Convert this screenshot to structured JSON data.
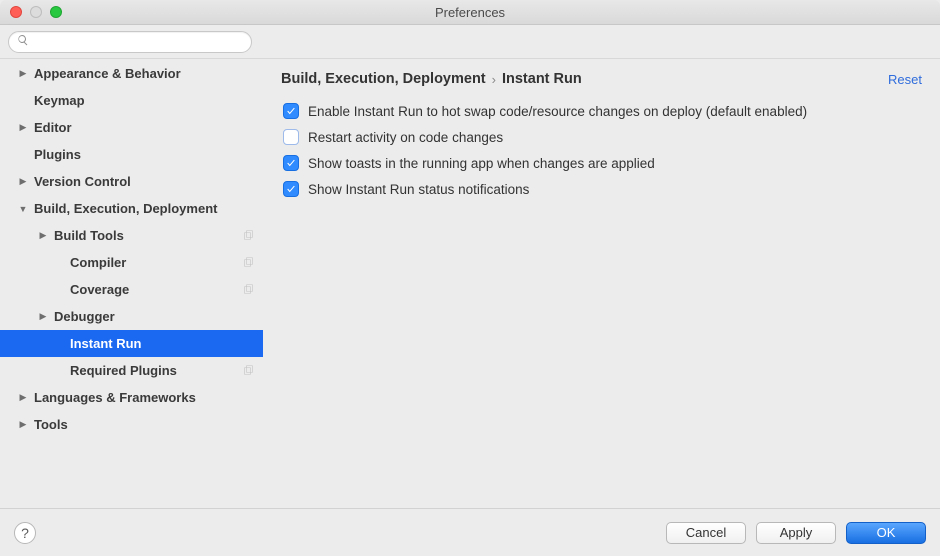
{
  "window": {
    "title": "Preferences"
  },
  "search": {
    "placeholder": ""
  },
  "sidebar": {
    "items": [
      {
        "label": "Appearance & Behavior",
        "depth": 0,
        "arrow": "right",
        "badge": false,
        "selected": false
      },
      {
        "label": "Keymap",
        "depth": 0,
        "arrow": "none",
        "badge": false,
        "selected": false
      },
      {
        "label": "Editor",
        "depth": 0,
        "arrow": "right",
        "badge": false,
        "selected": false
      },
      {
        "label": "Plugins",
        "depth": 0,
        "arrow": "none",
        "badge": false,
        "selected": false
      },
      {
        "label": "Version Control",
        "depth": 0,
        "arrow": "right",
        "badge": false,
        "selected": false
      },
      {
        "label": "Build, Execution, Deployment",
        "depth": 0,
        "arrow": "down",
        "badge": false,
        "selected": false
      },
      {
        "label": "Build Tools",
        "depth": 1,
        "arrow": "right",
        "badge": true,
        "selected": false
      },
      {
        "label": "Compiler",
        "depth": 2,
        "arrow": "none",
        "badge": true,
        "selected": false
      },
      {
        "label": "Coverage",
        "depth": 2,
        "arrow": "none",
        "badge": true,
        "selected": false
      },
      {
        "label": "Debugger",
        "depth": 1,
        "arrow": "right",
        "badge": false,
        "selected": false
      },
      {
        "label": "Instant Run",
        "depth": 2,
        "arrow": "none",
        "badge": false,
        "selected": true
      },
      {
        "label": "Required Plugins",
        "depth": 2,
        "arrow": "none",
        "badge": true,
        "selected": false
      },
      {
        "label": "Languages & Frameworks",
        "depth": 0,
        "arrow": "right",
        "badge": false,
        "selected": false
      },
      {
        "label": "Tools",
        "depth": 0,
        "arrow": "right",
        "badge": false,
        "selected": false
      }
    ]
  },
  "breadcrumb": {
    "parent": "Build, Execution, Deployment",
    "current": "Instant Run",
    "reset": "Reset"
  },
  "options": [
    {
      "checked": true,
      "label": "Enable Instant Run to hot swap code/resource changes on deploy (default enabled)"
    },
    {
      "checked": false,
      "label": "Restart activity on code changes"
    },
    {
      "checked": true,
      "label": "Show toasts in the running app when changes are applied"
    },
    {
      "checked": true,
      "label": "Show Instant Run status notifications"
    }
  ],
  "footer": {
    "help": "?",
    "cancel": "Cancel",
    "apply": "Apply",
    "ok": "OK"
  }
}
